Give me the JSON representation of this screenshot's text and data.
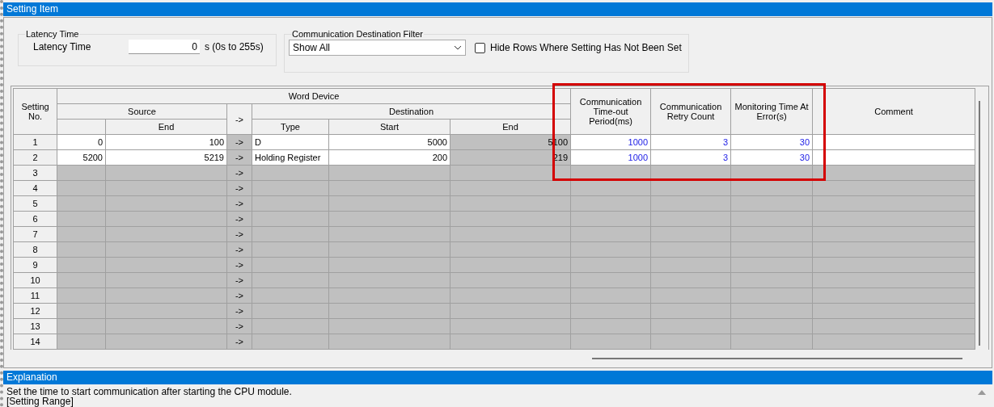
{
  "panel": {
    "title": "Setting Item"
  },
  "latency": {
    "group_title": "Latency Time",
    "label": "Latency Time",
    "value": "0",
    "unit": "s (0s to 255s)"
  },
  "filter": {
    "group_title": "Communication Destination Filter",
    "dropdown_value": "Show All",
    "checkbox_label": "Hide Rows Where Setting Has Not Been Set",
    "checked": false
  },
  "table": {
    "headers": {
      "setting_no": "Setting No.",
      "word_device": "Word Device",
      "source": "Source",
      "source_end": "End",
      "arrow": "->",
      "destination": "Destination",
      "type": "Type",
      "dest_start": "Start",
      "dest_end": "End",
      "timeout": "Communication Time-out Period(ms)",
      "retry": "Communication Retry Count",
      "monitoring": "Monitoring Time At Error(s)",
      "comment": "Comment"
    },
    "rows": [
      {
        "no": "1",
        "set": true,
        "source_start": "0",
        "source_end": "100",
        "arrow": "->",
        "type": "D",
        "dest_start": "5000",
        "dest_end": "5100",
        "timeout": "1000",
        "retry": "3",
        "monitoring": "30"
      },
      {
        "no": "2",
        "set": true,
        "source_start": "5200",
        "source_end": "5219",
        "arrow": "->",
        "type": "Holding Register",
        "dest_start": "200",
        "dest_end": "219",
        "timeout": "1000",
        "retry": "3",
        "monitoring": "30"
      },
      {
        "no": "3",
        "set": false,
        "arrow": "->"
      },
      {
        "no": "4",
        "set": false,
        "arrow": "->"
      },
      {
        "no": "5",
        "set": false,
        "arrow": "->"
      },
      {
        "no": "6",
        "set": false,
        "arrow": "->"
      },
      {
        "no": "7",
        "set": false,
        "arrow": "->"
      },
      {
        "no": "8",
        "set": false,
        "arrow": "->"
      },
      {
        "no": "9",
        "set": false,
        "arrow": "->"
      },
      {
        "no": "10",
        "set": false,
        "arrow": "->"
      },
      {
        "no": "11",
        "set": false,
        "arrow": "->"
      },
      {
        "no": "12",
        "set": false,
        "arrow": "->"
      },
      {
        "no": "13",
        "set": false,
        "arrow": "->"
      },
      {
        "no": "14",
        "set": false,
        "arrow": "->"
      }
    ]
  },
  "explanation": {
    "title": "Explanation",
    "lines": [
      "Set the time to start communication after starting the CPU module.",
      "[Setting Range]"
    ]
  }
}
